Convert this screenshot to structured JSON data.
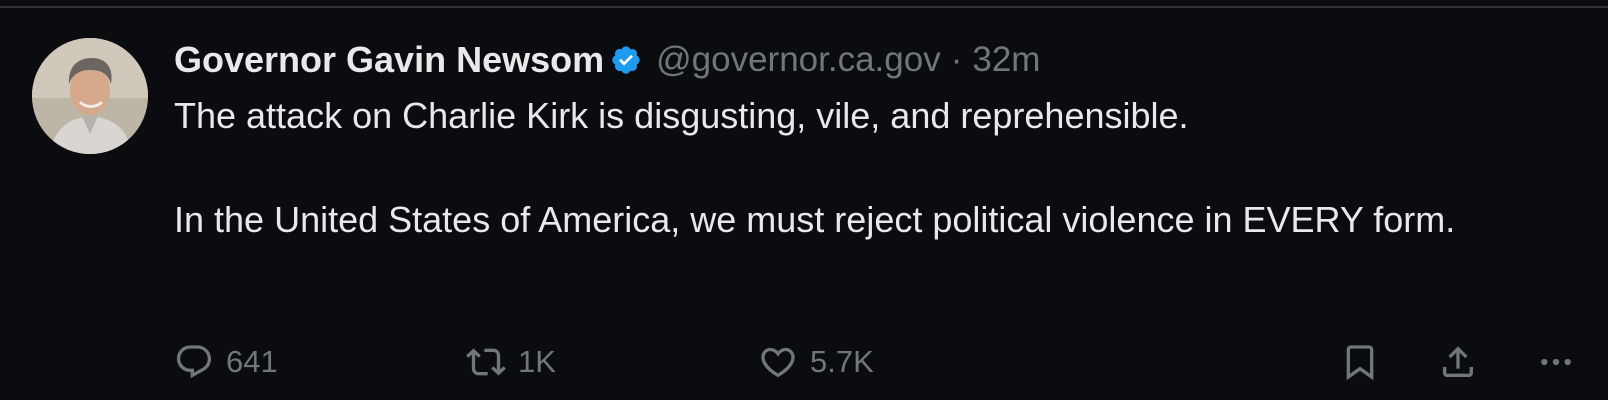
{
  "post": {
    "author": {
      "display_name": "Governor Gavin Newsom",
      "verified": true,
      "handle": "@governor.ca.gov",
      "separator": "·",
      "timestamp": "32m",
      "avatar_icon": "profile-photo"
    },
    "text": {
      "paragraph_1": "The attack on Charlie Kirk is disgusting, vile, and reprehensible.",
      "paragraph_2": "In the United States of America, we must reject political violence in EVERY form."
    },
    "actions": {
      "reply": {
        "icon": "reply-icon",
        "count": "641"
      },
      "repost": {
        "icon": "repost-icon",
        "count": "1K"
      },
      "like": {
        "icon": "heart-icon",
        "count": "5.7K"
      },
      "bookmark": {
        "icon": "bookmark-icon"
      },
      "share": {
        "icon": "share-icon"
      },
      "more": {
        "icon": "more-icon"
      }
    }
  },
  "colors": {
    "background": "#0a0c0f",
    "text_primary": "#e7e9ea",
    "text_secondary": "#71767b",
    "verified_badge": "#1d9bf0",
    "divider": "#2f3336"
  }
}
